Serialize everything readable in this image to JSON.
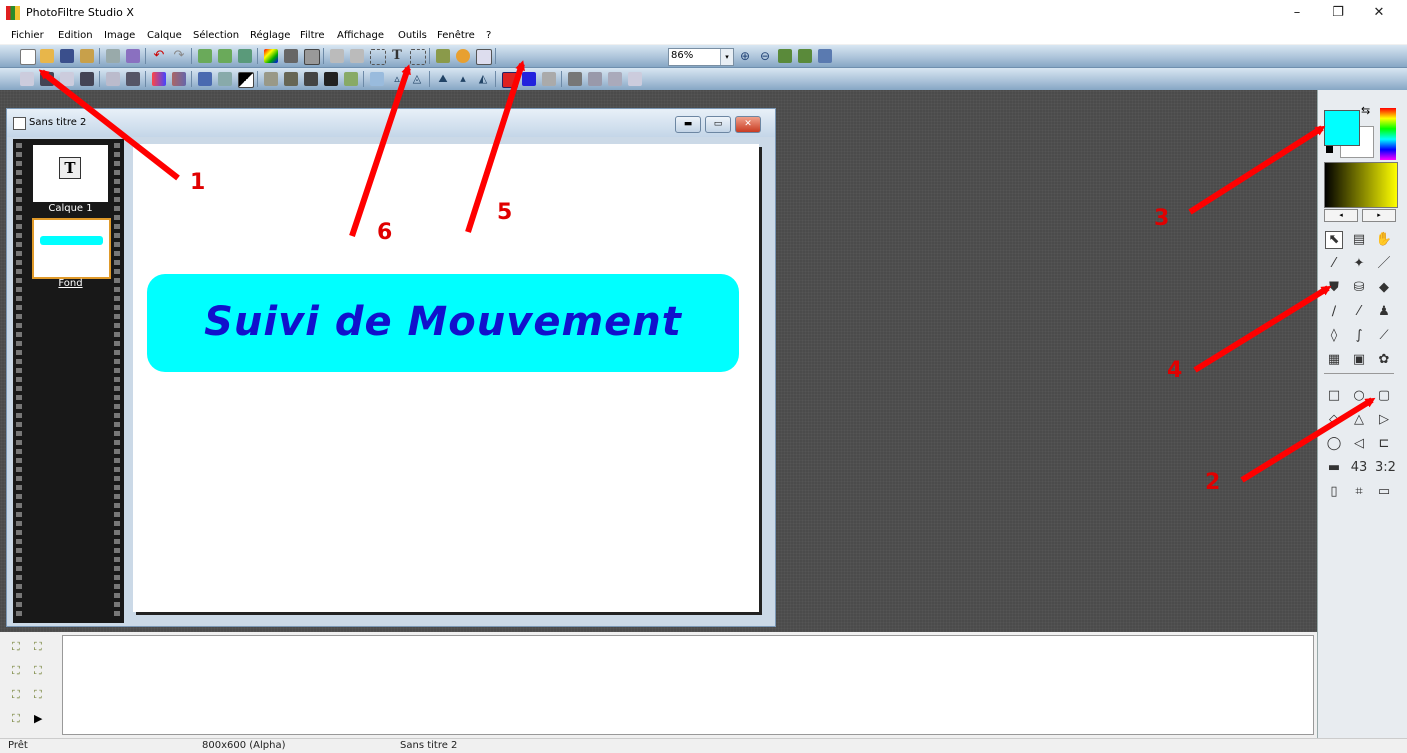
{
  "window": {
    "title": "PhotoFiltre Studio X",
    "controls": {
      "minimize": "–",
      "restore": "❐",
      "close": "✕"
    }
  },
  "menu": [
    "Fichier",
    "Edition",
    "Image",
    "Calque",
    "Sélection",
    "Réglage",
    "Filtre",
    "Affichage",
    "Outils",
    "Fenêtre",
    "?"
  ],
  "toolbar": {
    "zoom": "86%",
    "zoom_arrow": "▾"
  },
  "document": {
    "title": "Sans titre 2",
    "buttons": {
      "minimize": "▬",
      "maximize": "▭",
      "close": "✕"
    },
    "layers": [
      {
        "name": "Calque 1",
        "type": "text",
        "glyph": "T"
      },
      {
        "name": "Fond",
        "type": "image"
      }
    ],
    "banner_text": "Suivi de Mouvement",
    "banner_color": "#00ffff",
    "text_color": "#1111cc"
  },
  "palette": {
    "foreground": "#00ffff",
    "background": "#ffffff",
    "swap_icon": "swap-arrows-icon",
    "spin_left": "◂",
    "spin_right": "▸"
  },
  "tools": [
    "pointer-icon",
    "layer-manager-icon",
    "hand-icon",
    "eyedropper-icon",
    "magic-wand-icon",
    "line-icon",
    "fill-bucket-icon",
    "spray-icon",
    "eraser-icon",
    "brush-icon",
    "advanced-brush-icon",
    "stamp-icon",
    "blur-icon",
    "finger-icon",
    "clone-icon",
    "pattern-icon",
    "portrait-icon",
    "strawberry-icon",
    "rectangle-icon",
    "ellipse-icon",
    "rounded-rect-icon",
    "diamond-icon",
    "triangle-icon",
    "triangle-right-icon",
    "lasso-icon",
    "polygon-icon",
    "open-folder-icon",
    "frame-icon",
    "ratio-4-3-icon",
    "ratio-3-2-icon",
    "text-frame-icon",
    "crop-icon",
    "window-icon"
  ],
  "tool_glyphs": [
    "⬉",
    "▤",
    "✋",
    "⁄",
    "✦",
    "／",
    "⛊",
    "⛁",
    "◆",
    "∕",
    "⁄",
    "♟",
    "◊",
    "∫",
    "⟋",
    "▦",
    "▣",
    "✿",
    "□",
    "○",
    "▢",
    "◇",
    "△",
    "▷",
    "◯",
    "◁",
    "⊏",
    "▬",
    "43",
    "3:2",
    "▯",
    "⌗",
    "▭"
  ],
  "annotations": [
    "1",
    "2",
    "3",
    "4",
    "5",
    "6"
  ],
  "status": {
    "state": "Prêt",
    "size": "800x600 (Alpha)",
    "doc": "Sans titre 2"
  }
}
